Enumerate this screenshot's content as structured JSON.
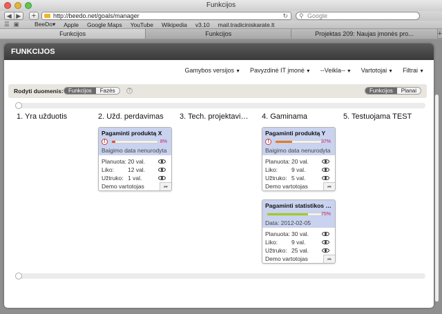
{
  "browser": {
    "window_title": "Funkcijos",
    "url": "http://beedo.net/goals/manager",
    "search_placeholder": "Google",
    "bookmarks": [
      "BeeDo▾",
      "Apple",
      "Google Maps",
      "YouTube",
      "Wikipedia",
      "v3.10",
      "mail.tradiciniskarate.lt"
    ],
    "tabs": [
      {
        "label": "Funkcijos"
      },
      {
        "label": "Funkcijos"
      },
      {
        "label": "Projektas 209: Naujas įmonės pro..."
      }
    ]
  },
  "panel": {
    "title": "FUNKCIJOS",
    "menus": [
      {
        "label": "Gamybos versijos"
      },
      {
        "label": "Pavyzdinė IT įmonė"
      },
      {
        "label": "--Veikla--"
      },
      {
        "label": "Vartotojai"
      },
      {
        "label": "Filtrai"
      }
    ],
    "filter": {
      "label": "Rodyti duomenis:",
      "options": [
        "Funkcijos",
        "Fazės"
      ],
      "selected": "Funkcijos",
      "help": "?",
      "view_options": [
        "Funkcijos",
        "Planai"
      ],
      "view_selected": "Funkcijos"
    }
  },
  "columns": [
    {
      "title": "1. Yra užduotis"
    },
    {
      "title": "2. Užd. perdavimas"
    },
    {
      "title": "3. Tech. projektavimas"
    },
    {
      "title": "4. Gaminama"
    },
    {
      "title": "5. Testuojama TEST"
    }
  ],
  "cards": {
    "x": {
      "title": "Pagaminti produktą X",
      "progress": 8,
      "progress_label": "8%",
      "bar_color": "#e05030",
      "date": "Baigimo data nenurodyta",
      "labels": {
        "planned": "Planuota:",
        "left": "Liko:",
        "took": "Užtruko:"
      },
      "planned": "20 val.",
      "left": "12 val.",
      "took": "1 val.",
      "owner": "Demo vartotojas"
    },
    "y": {
      "title": "Pagaminti produktą Y",
      "progress": 37,
      "progress_label": "37%",
      "bar_color": "#e07a30",
      "date": "Baigimo data nenurodyta",
      "labels": {
        "planned": "Planuota:",
        "left": "Liko:",
        "took": "Užtruko:"
      },
      "planned": "20 val.",
      "left": "9 val.",
      "took": "5 val.",
      "owner": "Demo vartotojas"
    },
    "stat": {
      "title": "Pagaminti statistikos m...",
      "progress": 75,
      "progress_label": "75%",
      "bar_color": "#9ccc2c",
      "date": "Data: 2012-02-05",
      "labels": {
        "planned": "Planuota:",
        "left": "Liko:",
        "took": "Užtruko:"
      },
      "planned": "30 val.",
      "left": "9 val.",
      "took": "25 val.",
      "owner": "Demo vartotojas"
    }
  }
}
